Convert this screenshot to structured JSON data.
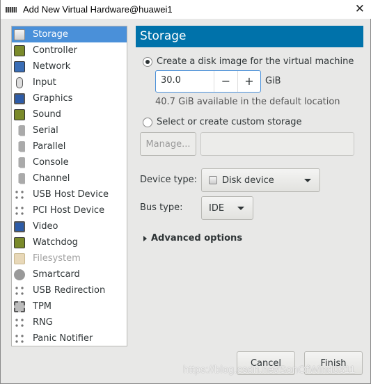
{
  "window": {
    "title": "Add New Virtual Hardware@huawei1",
    "close": "✕"
  },
  "sidebar": {
    "items": [
      {
        "label": "Storage",
        "icon": "disk-icon",
        "selected": true
      },
      {
        "label": "Controller",
        "icon": "card-icon"
      },
      {
        "label": "Network",
        "icon": "network-icon"
      },
      {
        "label": "Input",
        "icon": "mouse-icon"
      },
      {
        "label": "Graphics",
        "icon": "monitor-icon"
      },
      {
        "label": "Sound",
        "icon": "card-icon"
      },
      {
        "label": "Serial",
        "icon": "port-icon"
      },
      {
        "label": "Parallel",
        "icon": "port-icon"
      },
      {
        "label": "Console",
        "icon": "port-icon"
      },
      {
        "label": "Channel",
        "icon": "port-icon"
      },
      {
        "label": "USB Host Device",
        "icon": "usb-icon"
      },
      {
        "label": "PCI Host Device",
        "icon": "usb-icon"
      },
      {
        "label": "Video",
        "icon": "monitor-icon"
      },
      {
        "label": "Watchdog",
        "icon": "card-icon"
      },
      {
        "label": "Filesystem",
        "icon": "folder-icon",
        "disabled": true
      },
      {
        "label": "Smartcard",
        "icon": "smartcard-icon"
      },
      {
        "label": "USB Redirection",
        "icon": "usb-icon"
      },
      {
        "label": "TPM",
        "icon": "chip-icon"
      },
      {
        "label": "RNG",
        "icon": "usb-icon"
      },
      {
        "label": "Panic Notifier",
        "icon": "usb-icon"
      }
    ]
  },
  "main": {
    "header": "Storage",
    "create_option": "Create a disk image for the virtual machine",
    "size_value": "30.0",
    "minus": "−",
    "plus": "+",
    "unit": "GiB",
    "available": "40.7 GiB available in the default location",
    "custom_option": "Select or create custom storage",
    "manage": "Manage...",
    "custom_path": "",
    "device_type_label": "Device type:",
    "device_type": "Disk device",
    "bus_type_label": "Bus type:",
    "bus_type": "IDE",
    "advanced": "Advanced options"
  },
  "footer": {
    "cancel": "Cancel",
    "finish": "Finish"
  },
  "watermark": "https://blog.csdn.net/SonOfWind0311",
  "colors": {
    "accent": "#0072aa",
    "selection": "#4a90d9"
  }
}
